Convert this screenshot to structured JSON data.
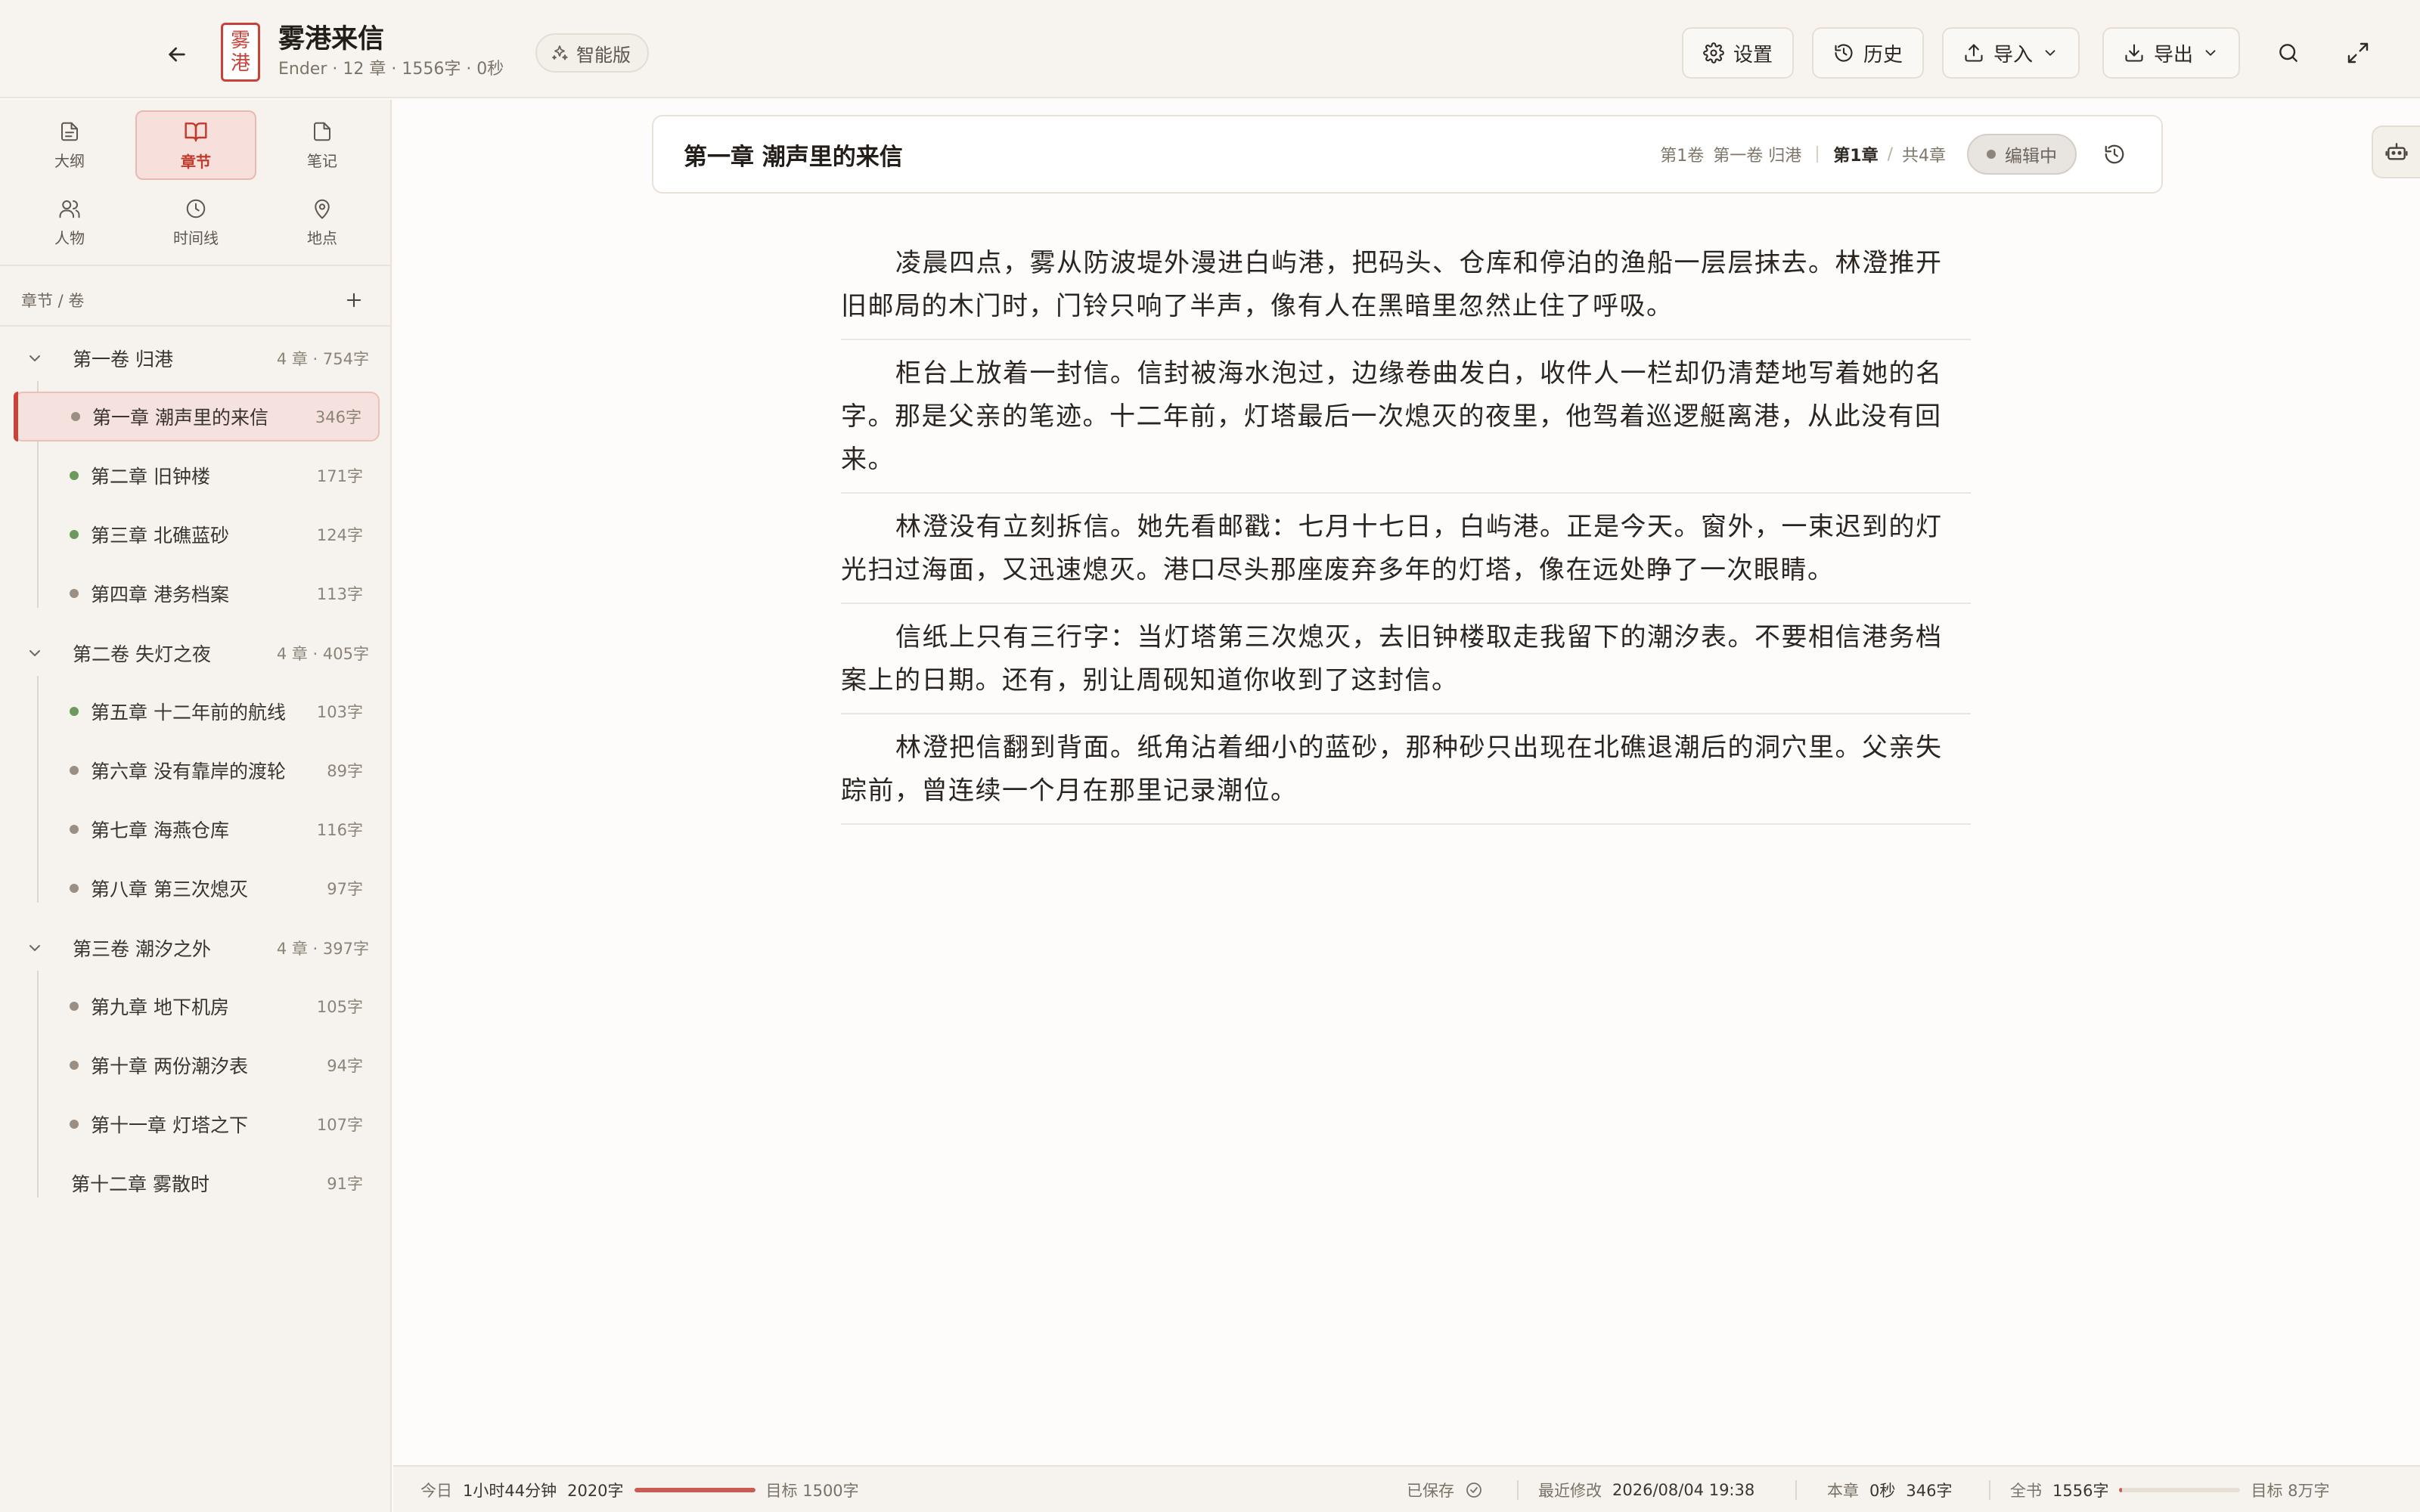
{
  "header": {
    "title": "雾港来信",
    "meta": "Ender · 12 章 · 1556字 · 0秒",
    "smart_label": "智能版",
    "logo_text_top": "雾",
    "logo_text_bottom": "港",
    "buttons": {
      "settings": "设置",
      "history": "历史",
      "import": "导入",
      "export": "导出"
    }
  },
  "sidebar": {
    "nav": [
      {
        "label": "大纲",
        "icon": "document-icon",
        "active": false
      },
      {
        "label": "章节",
        "icon": "book-icon",
        "active": true
      },
      {
        "label": "笔记",
        "icon": "note-icon",
        "active": false
      },
      {
        "label": "人物",
        "icon": "users-icon",
        "active": false
      },
      {
        "label": "时间线",
        "icon": "clock-icon",
        "active": false
      },
      {
        "label": "地点",
        "icon": "map-pin-icon",
        "active": false
      }
    ],
    "section_title": "章节 / 卷",
    "volumes": [
      {
        "title": "第一卷 归港",
        "meta": "4 章 · 754字",
        "chapters": [
          {
            "title": "第一章 潮声里的来信",
            "count": "346字",
            "dot": "#9a8f82"
          },
          {
            "title": "第二章 旧钟楼",
            "count": "171字",
            "dot": "#6c9a5a"
          },
          {
            "title": "第三章 北礁蓝砂",
            "count": "124字",
            "dot": "#6c9a5a"
          },
          {
            "title": "第四章 港务档案",
            "count": "113字",
            "dot": "#9a8f82"
          }
        ]
      },
      {
        "title": "第二卷 失灯之夜",
        "meta": "4 章 · 405字",
        "chapters": [
          {
            "title": "第五章 十二年前的航线",
            "count": "103字",
            "dot": "#6c9a5a"
          },
          {
            "title": "第六章 没有靠岸的渡轮",
            "count": "89字",
            "dot": "#9a8f82"
          },
          {
            "title": "第七章 海燕仓库",
            "count": "116字",
            "dot": "#9a8f82"
          },
          {
            "title": "第八章 第三次熄灭",
            "count": "97字",
            "dot": "#9a8f82"
          }
        ]
      },
      {
        "title": "第三卷 潮汐之外",
        "meta": "4 章 · 397字",
        "chapters": [
          {
            "title": "第九章 地下机房",
            "count": "105字",
            "dot": "#9a8f82"
          },
          {
            "title": "第十章 两份潮汐表",
            "count": "94字",
            "dot": "#9a8f82"
          },
          {
            "title": "第十一章 灯塔之下",
            "count": "107字",
            "dot": "#9a8f82"
          },
          {
            "title": "第十二章 雾散时",
            "count": "91字",
            "dot": ""
          }
        ]
      }
    ]
  },
  "chapter": {
    "title": "第一章 潮声里的来信",
    "crumb_vol_num": "第1卷",
    "crumb_vol_name": "第一卷 归港",
    "crumb_ch": "第1章",
    "crumb_sep": "/",
    "crumb_total": "共4章",
    "status": "编辑中",
    "paragraphs": [
      "凌晨四点，雾从防波堤外漫进白屿港，把码头、仓库和停泊的渔船一层层抹去。林澄推开旧邮局的木门时，门铃只响了半声，像有人在黑暗里忽然止住了呼吸。",
      "柜台上放着一封信。信封被海水泡过，边缘卷曲发白，收件人一栏却仍清楚地写着她的名字。那是父亲的笔迹。十二年前，灯塔最后一次熄灭的夜里，他驾着巡逻艇离港，从此没有回来。",
      "林澄没有立刻拆信。她先看邮戳：七月十七日，白屿港。正是今天。窗外，一束迟到的灯光扫过海面，又迅速熄灭。港口尽头那座废弃多年的灯塔，像在远处睁了一次眼睛。",
      "信纸上只有三行字：当灯塔第三次熄灭，去旧钟楼取走我留下的潮汐表。不要相信港务档案上的日期。还有，别让周砚知道你收到了这封信。",
      "林澄把信翻到背面。纸角沾着细小的蓝砂，那种砂只出现在北礁退潮后的洞穴里。父亲失踪前，曾连续一个月在那里记录潮位。"
    ]
  },
  "statusbar": {
    "today_label": "今日",
    "today_time": "1小时44分钟",
    "today_words": "2020字",
    "today_goal": "目标 1500字",
    "today_progress": 1.0,
    "saved": "已保存",
    "modified_label": "最近修改",
    "modified_value": "2026/08/04 19:38",
    "chapter_label": "本章",
    "chapter_time": "0秒",
    "chapter_words": "346字",
    "book_label": "全书",
    "book_words": "1556字",
    "book_goal": "目标 8万字",
    "book_progress": 0.02
  },
  "colors": {
    "accent": "#c8423a",
    "background": "#fbf9f6"
  }
}
